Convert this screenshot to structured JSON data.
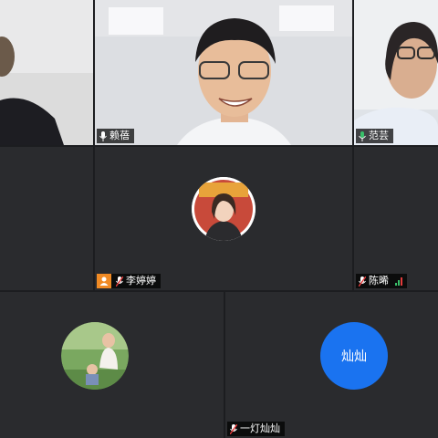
{
  "participants": {
    "p1": {
      "name": ""
    },
    "p2": {
      "name": "赖蓓"
    },
    "p3": {
      "name": "范芸"
    },
    "p4": {
      "name": "李婷婷"
    },
    "p5": {
      "name": "陈晞"
    },
    "p6": {
      "name": ""
    },
    "p7": {
      "name": "一灯灿灿",
      "avatar_text": "灿灿"
    }
  },
  "colors": {
    "background": "#1c1d20",
    "tile": "#2a2b2e",
    "avatar_blue": "#1a73f0",
    "signal_green": "#39c06a",
    "badge_orange": "#f08a24"
  },
  "icons": [
    "mic-icon",
    "mic-muted-icon",
    "signal-icon",
    "host-badge-icon"
  ]
}
